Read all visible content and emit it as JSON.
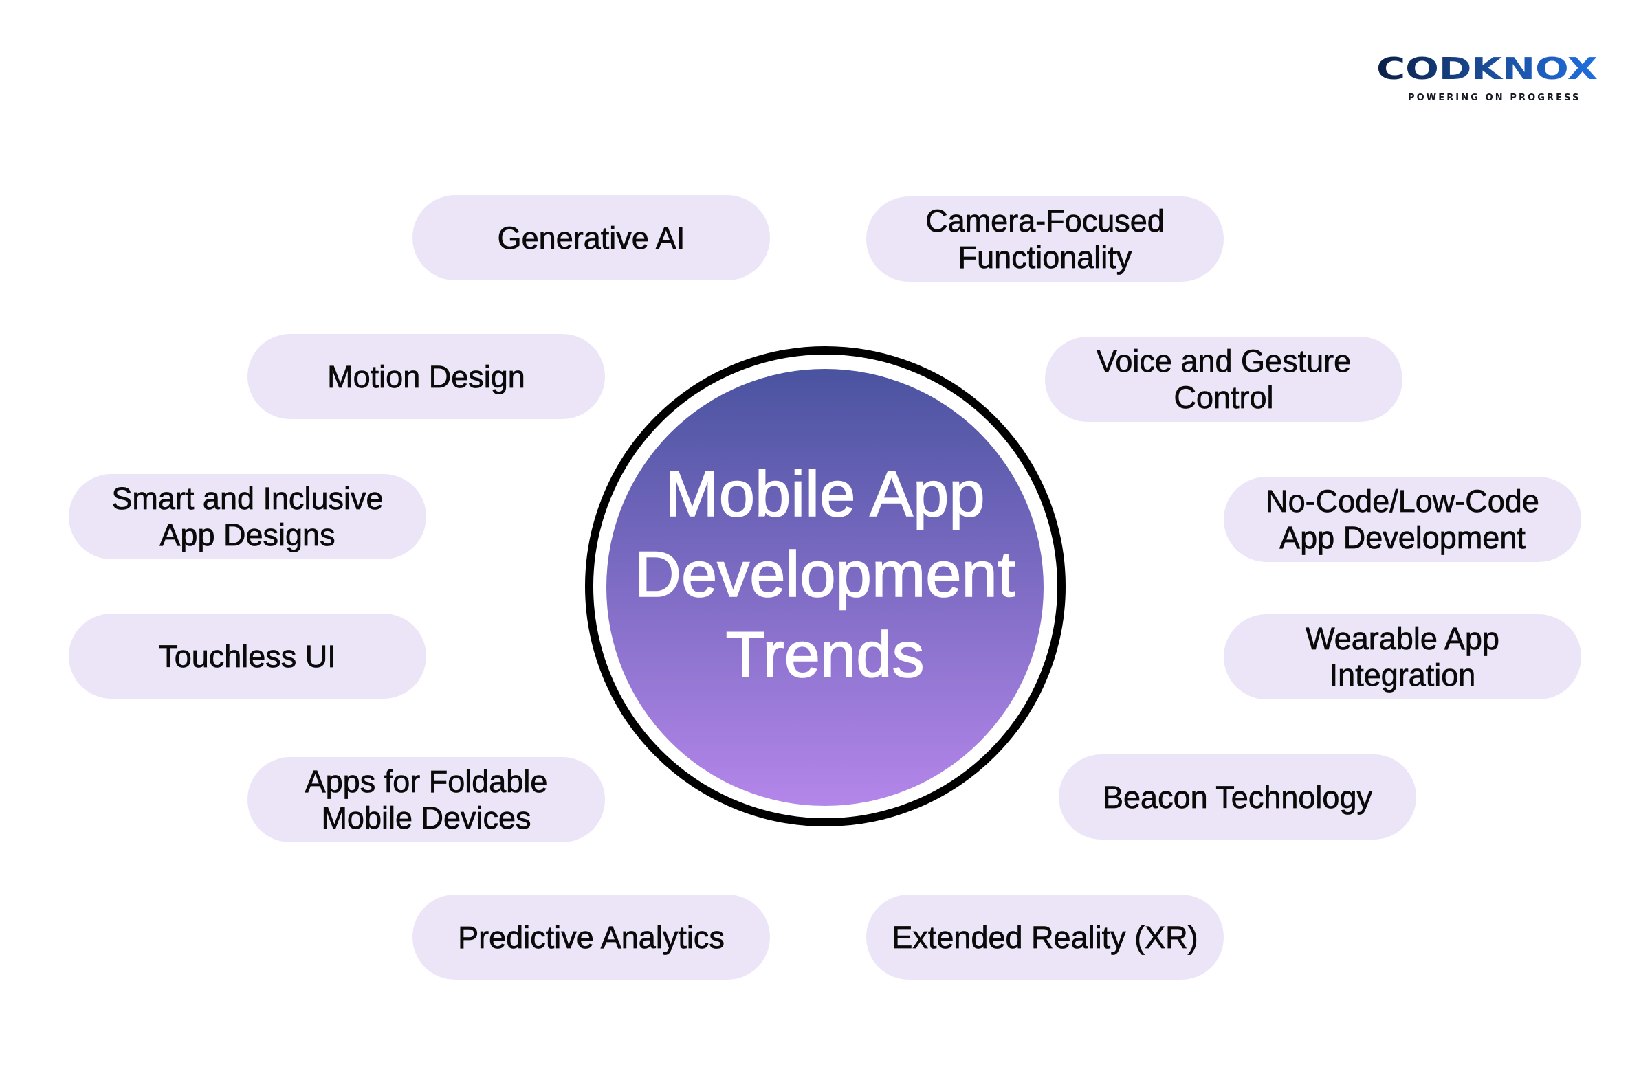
{
  "brand": {
    "name": "CODKNOX",
    "tagline": "POWERING ON PROGRESS",
    "colors": {
      "start": "#0B1F45",
      "mid": "#1B4C98",
      "end": "#1F6FE0"
    }
  },
  "hub": {
    "title": "Mobile App\nDevelopment\nTrends",
    "gradient_top": "#4A53A0",
    "gradient_bottom": "#B486EA",
    "ring_color": "#000000"
  },
  "pill_color": "#ECE5F7",
  "trends": [
    {
      "label": "Generative AI"
    },
    {
      "label": "Camera-Focused\nFunctionality"
    },
    {
      "label": "Motion Design"
    },
    {
      "label": "Voice and Gesture\nControl"
    },
    {
      "label": "Smart and Inclusive\nApp Designs"
    },
    {
      "label": "No-Code/Low-Code\nApp Development"
    },
    {
      "label": "Touchless UI"
    },
    {
      "label": "Wearable App\nIntegration"
    },
    {
      "label": "Apps for Foldable\nMobile Devices"
    },
    {
      "label": "Beacon Technology"
    },
    {
      "label": "Predictive Analytics"
    },
    {
      "label": "Extended Reality (XR)"
    }
  ]
}
